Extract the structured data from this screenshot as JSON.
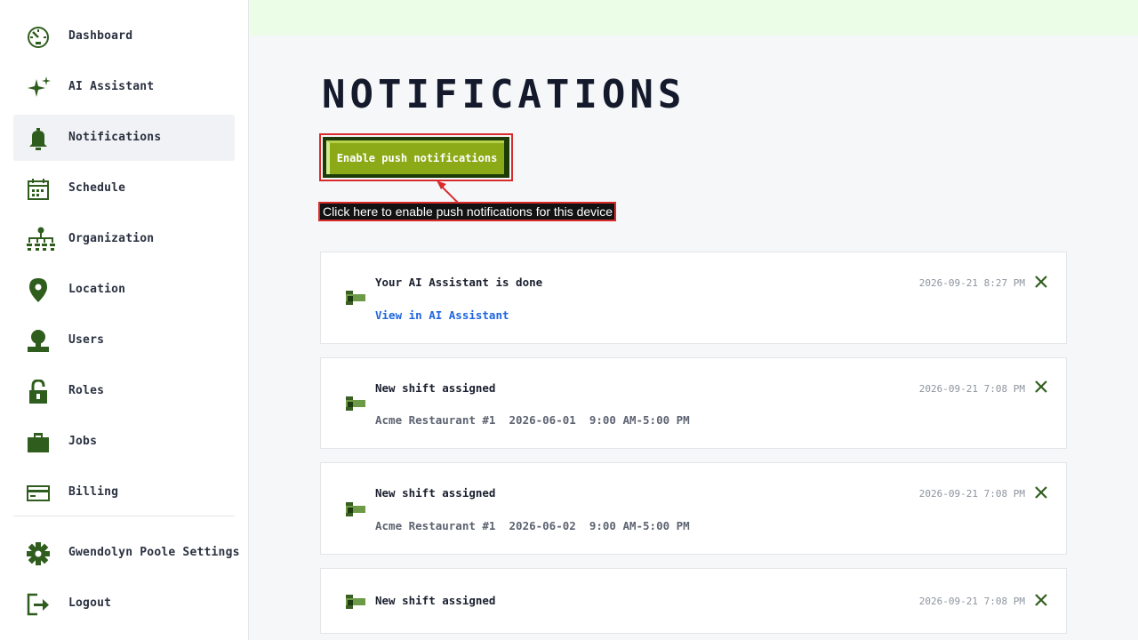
{
  "sidebar": {
    "items": [
      {
        "label": "Dashboard",
        "icon": "dashboard-icon"
      },
      {
        "label": "AI Assistant",
        "icon": "sparkle-icon"
      },
      {
        "label": "Notifications",
        "icon": "bell-icon",
        "active": true
      },
      {
        "label": "Schedule",
        "icon": "calendar-icon"
      },
      {
        "label": "Organization",
        "icon": "org-chart-icon"
      },
      {
        "label": "Location",
        "icon": "location-pin-icon"
      },
      {
        "label": "Users",
        "icon": "user-icon"
      },
      {
        "label": "Roles",
        "icon": "lock-icon"
      },
      {
        "label": "Jobs",
        "icon": "briefcase-icon"
      },
      {
        "label": "Billing",
        "icon": "credit-card-icon"
      }
    ],
    "settings_label": "Gwendolyn Poole Settings",
    "logout_label": "Logout"
  },
  "main": {
    "title": "NOTIFICATIONS",
    "push_button_label": "Enable push notifications",
    "hint": "Click here to enable push notifications for this device"
  },
  "notifications": [
    {
      "title": "Your AI Assistant is done",
      "time": "2026-09-21 8:27 PM",
      "link": "View in AI Assistant"
    },
    {
      "title": "New shift assigned",
      "time": "2026-09-21 7:08 PM",
      "detail": "Acme Restaurant #1  2026-06-01  9:00 AM-5:00 PM"
    },
    {
      "title": "New shift assigned",
      "time": "2026-09-21 7:08 PM",
      "detail": "Acme Restaurant #1  2026-06-02  9:00 AM-5:00 PM"
    },
    {
      "title": "New shift assigned",
      "time": "2026-09-21 7:08 PM"
    }
  ],
  "colors": {
    "icon_green": "#2f5d1e",
    "accent_green": "#8caa18",
    "dark_green": "#1c3b09",
    "link_blue": "#1f66e0",
    "highlight_red": "#d92b2b",
    "topbar_green": "#ebfde6"
  }
}
